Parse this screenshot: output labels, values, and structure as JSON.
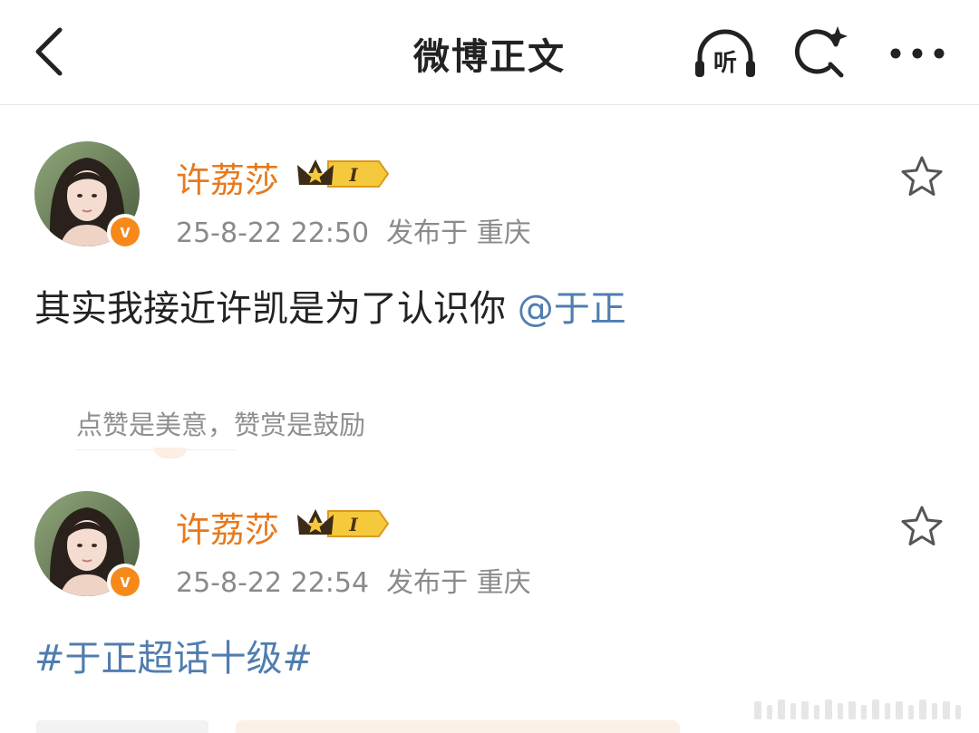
{
  "header": {
    "title": "微博正文",
    "listen_label": "听"
  },
  "posts": [
    {
      "username": "许荔莎",
      "badge_level": "I",
      "timestamp": "25-8-22 22:50",
      "location": "发布于 重庆",
      "text": "其实我接近许凯是为了认识你 ",
      "mention": "@于正",
      "verified_label": "v"
    },
    {
      "username": "许荔莎",
      "badge_level": "I",
      "timestamp": "25-8-22 22:54",
      "location": "发布于 重庆",
      "topic": "#于正超话十级#",
      "verified_label": "v"
    }
  ],
  "reward_tip": "点赞是美意，赞赏是鼓励",
  "colors": {
    "username": "#e8791d",
    "link": "#507daf",
    "meta": "#8a8a8a",
    "verified": "#f7891b"
  }
}
